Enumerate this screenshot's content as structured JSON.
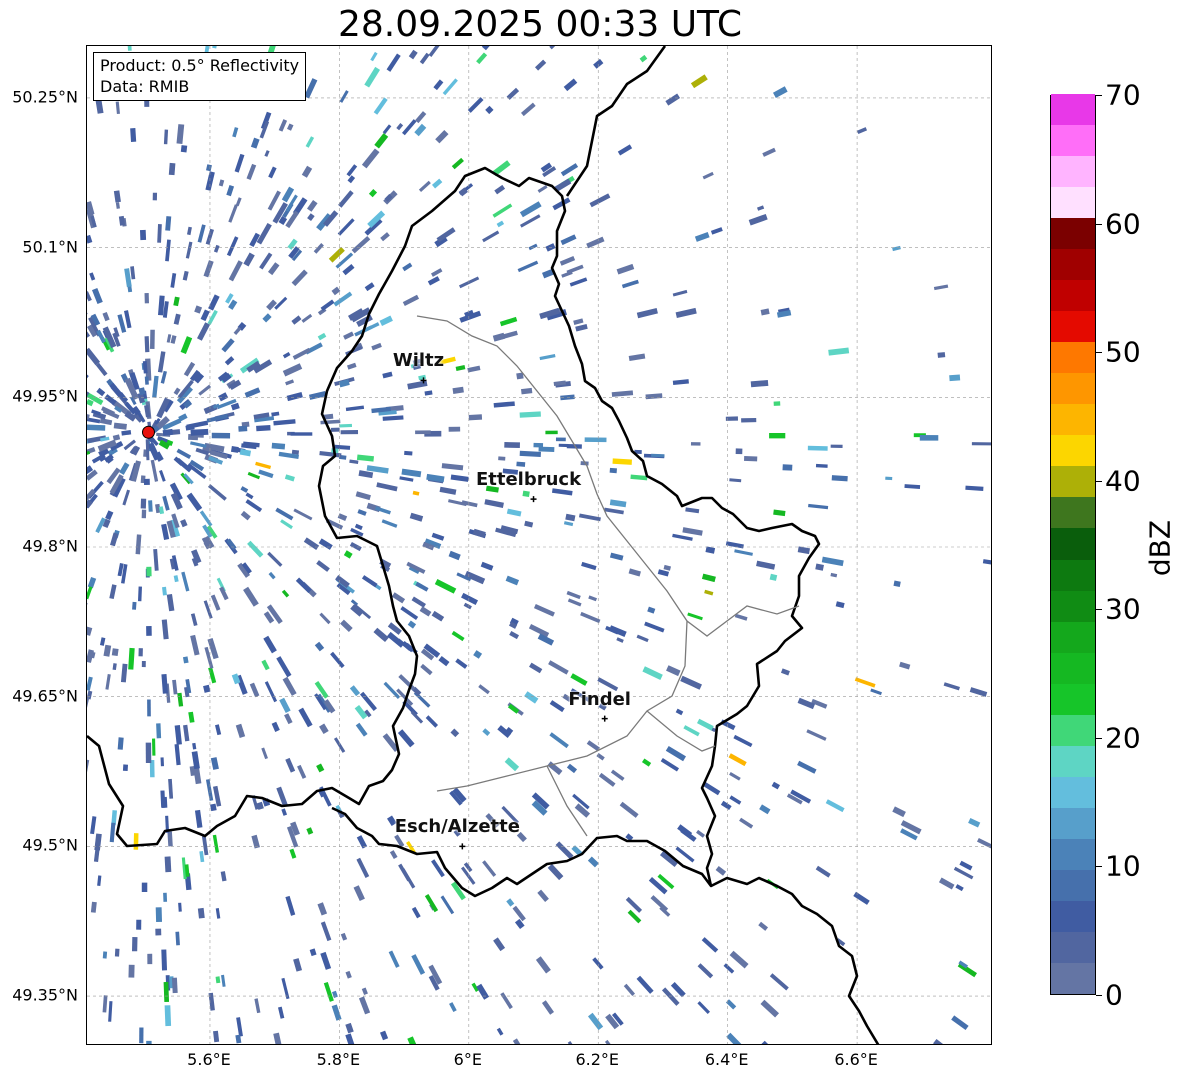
{
  "title": "28.09.2025 00:33 UTC",
  "info": {
    "product": "Product: 0.5° Reflectivity",
    "data": "Data: RMIB"
  },
  "axes": {
    "lon_min": 5.41,
    "lon_max": 6.81,
    "lat_min": 49.3,
    "lat_max": 50.302,
    "lat_ticks": [
      {
        "value": 50.25,
        "label": "50.25°N"
      },
      {
        "value": 50.1,
        "label": "50.1°N"
      },
      {
        "value": 49.95,
        "label": "49.95°N"
      },
      {
        "value": 49.8,
        "label": "49.8°N"
      },
      {
        "value": 49.65,
        "label": "49.65°N"
      },
      {
        "value": 49.5,
        "label": "49.5°N"
      },
      {
        "value": 49.35,
        "label": "49.35°N"
      }
    ],
    "lon_ticks": [
      {
        "value": 5.6,
        "label": "5.6°E"
      },
      {
        "value": 5.8,
        "label": "5.8°E"
      },
      {
        "value": 6.0,
        "label": "6°E"
      },
      {
        "value": 6.2,
        "label": "6.2°E"
      },
      {
        "value": 6.4,
        "label": "6.4°E"
      },
      {
        "value": 6.6,
        "label": "6.6°E"
      }
    ]
  },
  "radar_site": {
    "lon": 5.505,
    "lat": 49.915,
    "color": "#e8120c"
  },
  "cities": [
    {
      "name": "Wiltz",
      "lon": 5.93,
      "lat": 49.967
    },
    {
      "name": "Ettelbruck",
      "lon": 6.1,
      "lat": 49.848
    },
    {
      "name": "Findel",
      "lon": 6.21,
      "lat": 49.628
    },
    {
      "name": "Esch/Alzette",
      "lon": 5.99,
      "lat": 49.5
    }
  ],
  "colorbar": {
    "label": "dBZ",
    "min": 0,
    "max": 70,
    "ticks": [
      0,
      10,
      20,
      30,
      40,
      50,
      60,
      70
    ],
    "colors": [
      "#6475a4",
      "#5166a0",
      "#405ca2",
      "#4670ac",
      "#4b82b8",
      "#579fcb",
      "#63bedd",
      "#5ed5c4",
      "#40d778",
      "#16c529",
      "#15b822",
      "#14a81c",
      "#108c14",
      "#0d7a10",
      "#0a5e0c",
      "#3e761e",
      "#adb007",
      "#fcd600",
      "#fdb500",
      "#fe9600",
      "#fe7800",
      "#e40a00",
      "#c00000",
      "#a00000",
      "#7b0000",
      "#ffe0ff",
      "#ffb4ff",
      "#ff6ef8",
      "#e838e8"
    ]
  }
}
